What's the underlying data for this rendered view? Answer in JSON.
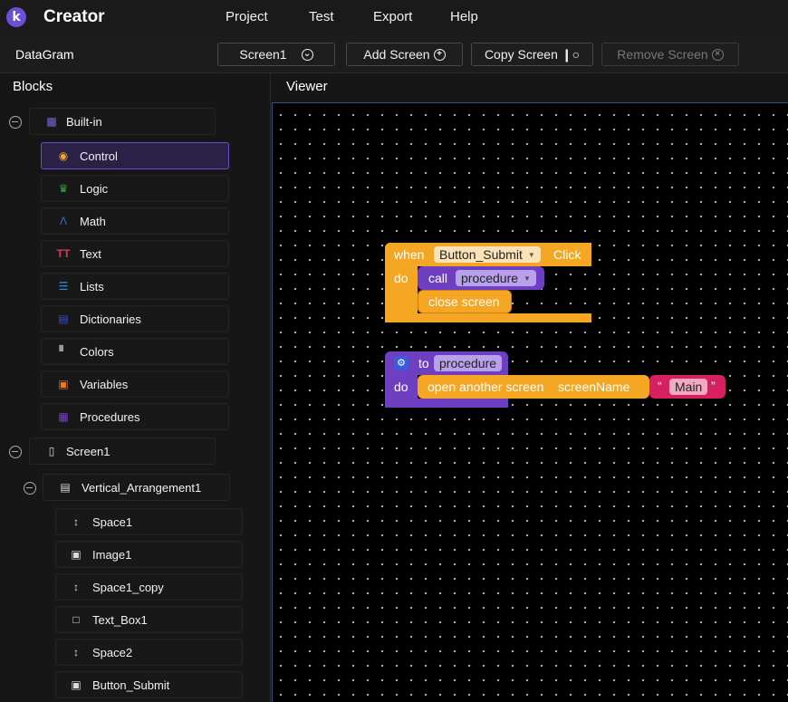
{
  "app": {
    "logo_letter": "k",
    "title": "Creator"
  },
  "menu": [
    "Project",
    "Test",
    "Export",
    "Help"
  ],
  "project": {
    "name": "DataGram",
    "screen_select": "Screen1",
    "add_screen": "Add Screen",
    "copy_screen": "Copy Screen",
    "remove_screen": "Remove Screen"
  },
  "blocks_panel": {
    "title": "Blocks",
    "builtin": "Built-in",
    "builtin_items": [
      "Control",
      "Logic",
      "Math",
      "Text",
      "Lists",
      "Dictionaries",
      "Colors",
      "Variables",
      "Procedures"
    ],
    "screen": "Screen1",
    "arrangement": "Vertical_Arrangement1",
    "components": [
      "Space1",
      "Image1",
      "Space1_copy",
      "Text_Box1",
      "Space2",
      "Button_Submit"
    ]
  },
  "viewer": {
    "title": "Viewer",
    "event_block": {
      "when": "when",
      "component": "Button_Submit",
      "event": "Click",
      "do": "do",
      "call": "call",
      "procedure": "procedure",
      "close": "close screen"
    },
    "proc_block": {
      "to": "to",
      "name": "procedure",
      "do": "do",
      "open": "open another screen",
      "param": "screenName",
      "quote_open": "“",
      "value": "Main",
      "quote_close": "”"
    }
  },
  "colors": {
    "accent": "#6b4fd6",
    "control": "#f5a623",
    "procedure": "#6e3fc0",
    "text": "#d6205f"
  }
}
